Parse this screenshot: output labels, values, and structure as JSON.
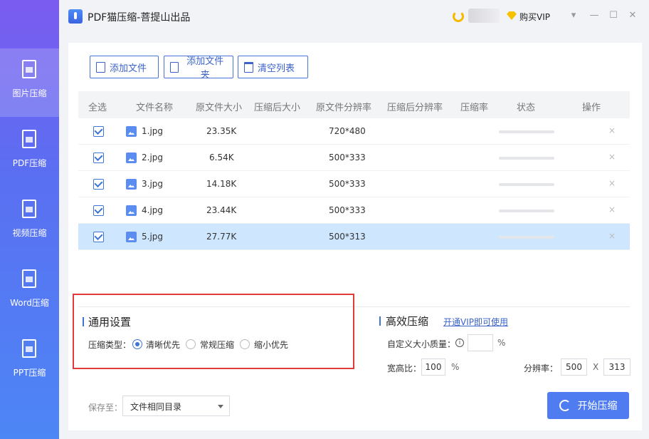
{
  "window": {
    "title": "PDF猫压缩-菩提山出品",
    "vip_label": "购买VIP",
    "controls": [
      "▾",
      "—",
      "☐",
      "✕"
    ]
  },
  "sidebar": {
    "items": [
      {
        "label": "图片压缩",
        "icon": "image-icon",
        "active": true
      },
      {
        "label": "PDF压缩",
        "icon": "pdf-icon",
        "active": false
      },
      {
        "label": "视频压缩",
        "icon": "video-icon",
        "active": false
      },
      {
        "label": "Word压缩",
        "icon": "word-icon",
        "active": false
      },
      {
        "label": "PPT压缩",
        "icon": "ppt-icon",
        "active": false
      }
    ]
  },
  "toolbar": {
    "add_file": "添加文件",
    "add_folder": "添加文件夹",
    "clear_list": "清空列表"
  },
  "table": {
    "columns": [
      "全选",
      "文件名称",
      "原文件大小",
      "压缩后大小",
      "原文件分辨率",
      "压缩后分辨率",
      "压缩率",
      "状态",
      "操作"
    ],
    "rows": [
      {
        "name": "1.jpg",
        "size": "23.35K",
        "resolution": "720*480",
        "checked": true,
        "selected": false
      },
      {
        "name": "2.jpg",
        "size": "6.54K",
        "resolution": "500*333",
        "checked": true,
        "selected": false
      },
      {
        "name": "3.jpg",
        "size": "14.18K",
        "resolution": "500*333",
        "checked": true,
        "selected": false
      },
      {
        "name": "4.jpg",
        "size": "23.44K",
        "resolution": "500*333",
        "checked": true,
        "selected": false
      },
      {
        "name": "5.jpg",
        "size": "27.77K",
        "resolution": "500*313",
        "checked": true,
        "selected": true
      }
    ],
    "delete_glyph": "×"
  },
  "general": {
    "title": "通用设置",
    "type_label": "压缩类型：",
    "options": [
      "清晰优先",
      "常规压缩",
      "缩小优先"
    ],
    "selected_option": "清晰优先"
  },
  "efficient": {
    "title": "高效压缩",
    "vip_link": "开通VIP即可使用",
    "custom_quality_label": "自定义大小质量：",
    "info_glyph": "i",
    "quality_value": "",
    "quality_unit": "%",
    "ratio_label": "宽高比：",
    "ratio_value": "100",
    "ratio_unit": "%",
    "resolution_label": "分辨率：",
    "res_width": "500",
    "res_sep": "X",
    "res_height": "313"
  },
  "footer": {
    "save_label": "保存至：",
    "save_value": "文件相同目录",
    "start_button": "开始压缩"
  }
}
